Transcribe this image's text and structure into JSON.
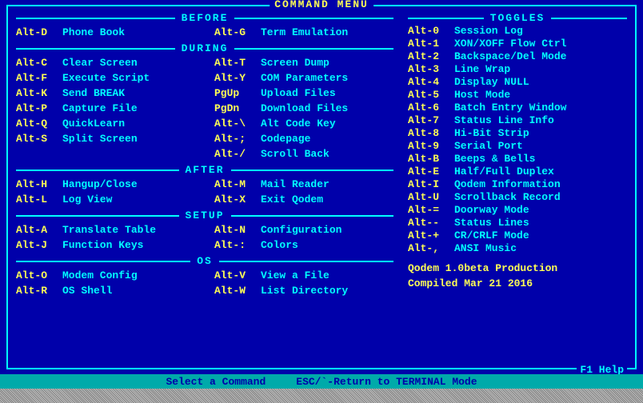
{
  "title": "COMMAND MENU",
  "f1": "F1 Help",
  "sections_left": [
    {
      "label": "BEFORE",
      "rows": [
        [
          {
            "key": "Alt-D",
            "desc": "Phone Book"
          },
          {
            "key": "Alt-G",
            "desc": "Term Emulation"
          }
        ]
      ]
    },
    {
      "label": "DURING",
      "rows": [
        [
          {
            "key": "Alt-C",
            "desc": "Clear Screen"
          },
          {
            "key": "Alt-T",
            "desc": "Screen Dump"
          }
        ],
        [
          {
            "key": "Alt-F",
            "desc": "Execute Script"
          },
          {
            "key": "Alt-Y",
            "desc": "COM Parameters"
          }
        ],
        [
          {
            "key": "Alt-K",
            "desc": "Send BREAK"
          },
          {
            "key": "PgUp",
            "desc": "Upload Files"
          }
        ],
        [
          {
            "key": "Alt-P",
            "desc": "Capture File"
          },
          {
            "key": "PgDn",
            "desc": "Download Files"
          }
        ],
        [
          {
            "key": "Alt-Q",
            "desc": "QuickLearn"
          },
          {
            "key": "Alt-\\",
            "desc": "Alt Code Key"
          }
        ],
        [
          {
            "key": "Alt-S",
            "desc": "Split Screen"
          },
          {
            "key": "Alt-;",
            "desc": "Codepage"
          }
        ],
        [
          {
            "key": "",
            "desc": ""
          },
          {
            "key": "Alt-/",
            "desc": "Scroll Back"
          }
        ]
      ]
    },
    {
      "label": "AFTER",
      "rows": [
        [
          {
            "key": "Alt-H",
            "desc": "Hangup/Close"
          },
          {
            "key": "Alt-M",
            "desc": "Mail Reader"
          }
        ],
        [
          {
            "key": "Alt-L",
            "desc": "Log View"
          },
          {
            "key": "Alt-X",
            "desc": "Exit Qodem"
          }
        ]
      ]
    },
    {
      "label": "SETUP",
      "rows": [
        [
          {
            "key": "Alt-A",
            "desc": "Translate Table"
          },
          {
            "key": "Alt-N",
            "desc": "Configuration"
          }
        ],
        [
          {
            "key": "Alt-J",
            "desc": "Function Keys"
          },
          {
            "key": "Alt-:",
            "desc": "Colors"
          }
        ]
      ]
    },
    {
      "label": "OS",
      "rows": [
        [
          {
            "key": "Alt-O",
            "desc": "Modem Config"
          },
          {
            "key": "Alt-V",
            "desc": "View a File"
          }
        ],
        [
          {
            "key": "Alt-R",
            "desc": "OS Shell"
          },
          {
            "key": "Alt-W",
            "desc": "List Directory"
          }
        ]
      ]
    }
  ],
  "toggles": {
    "label": "TOGGLES",
    "rows": [
      {
        "key": "Alt-0",
        "desc": "Session Log"
      },
      {
        "key": "Alt-1",
        "desc": "XON/XOFF Flow Ctrl"
      },
      {
        "key": "Alt-2",
        "desc": "Backspace/Del Mode"
      },
      {
        "key": "Alt-3",
        "desc": "Line Wrap"
      },
      {
        "key": "Alt-4",
        "desc": "Display NULL"
      },
      {
        "key": "Alt-5",
        "desc": "Host Mode"
      },
      {
        "key": "Alt-6",
        "desc": "Batch Entry Window"
      },
      {
        "key": "Alt-7",
        "desc": "Status Line Info"
      },
      {
        "key": "Alt-8",
        "desc": "Hi-Bit Strip"
      },
      {
        "key": "Alt-9",
        "desc": "Serial Port"
      },
      {
        "key": "Alt-B",
        "desc": "Beeps & Bells"
      },
      {
        "key": "Alt-E",
        "desc": "Half/Full Duplex"
      },
      {
        "key": "Alt-I",
        "desc": "Qodem Information"
      },
      {
        "key": "Alt-U",
        "desc": "Scrollback Record"
      },
      {
        "key": "Alt-=",
        "desc": "Doorway Mode"
      },
      {
        "key": "Alt--",
        "desc": "Status Lines"
      },
      {
        "key": "Alt-+",
        "desc": "CR/CRLF Mode"
      },
      {
        "key": "Alt-,",
        "desc": "ANSI Music"
      }
    ]
  },
  "version": {
    "line1": "Qodem 1.0beta Production",
    "line2": "Compiled Mar 21 2016"
  },
  "status": {
    "select": "Select a Command",
    "esc": "ESC/`-Return to TERMINAL Mode"
  }
}
